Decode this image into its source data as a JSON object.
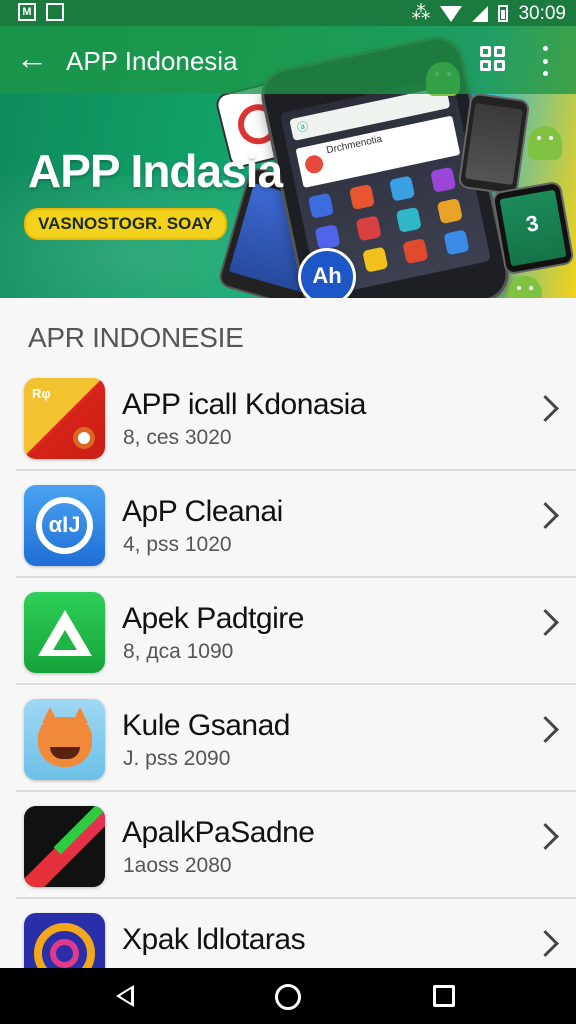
{
  "status_bar": {
    "left_icons": [
      "M",
      "photo"
    ],
    "time": "30:09",
    "icons": [
      "vibrate-icon",
      "wifi-icon",
      "signal-icon",
      "battery-icon"
    ]
  },
  "app_bar": {
    "title": "APP Indonesia",
    "back_icon": "arrow-left-icon",
    "grid_icon": "grid-icon",
    "more_icon": "more-vertical-icon"
  },
  "banner": {
    "title": "APP Indasia",
    "pill_text": "VASNOSTOGR. SOAY",
    "phone_search_text": "ⓐ",
    "phone_header_text": "Drchmenotia",
    "badge_text": "Ah",
    "small_phone_text": "3"
  },
  "section": {
    "title": "APR INDONESIE"
  },
  "apps": [
    {
      "name": "APP icall Kdonasia",
      "meta": "8, ces 3020",
      "icon": "app-icon-red-yellow",
      "glyph": "Rφ"
    },
    {
      "name": "ApP Cleanai",
      "meta": "4, pss 1020",
      "icon": "app-icon-blue-ring",
      "glyph": "αIJ"
    },
    {
      "name": "Apek Padtgire",
      "meta": "8, дca 1090",
      "icon": "app-icon-green-triangle",
      "glyph": ""
    },
    {
      "name": "Kule Gsanad",
      "meta": "J. pss 2090",
      "icon": "app-icon-fox-face",
      "glyph": ""
    },
    {
      "name": "ApalkPaSadne",
      "meta": "1aoss 2080",
      "icon": "app-icon-black-stripe",
      "glyph": ""
    },
    {
      "name": "Xpak ldlotaras",
      "meta": "",
      "icon": "app-icon-rings",
      "glyph": ""
    }
  ],
  "colors": {
    "app_bar": "#1e9646",
    "status_bar": "#1b7a3e",
    "pill": "#f2d21a",
    "nav_bar": "#000000"
  },
  "nav": {
    "back": "nav-back-icon",
    "home": "nav-home-icon",
    "recents": "nav-recents-icon"
  }
}
